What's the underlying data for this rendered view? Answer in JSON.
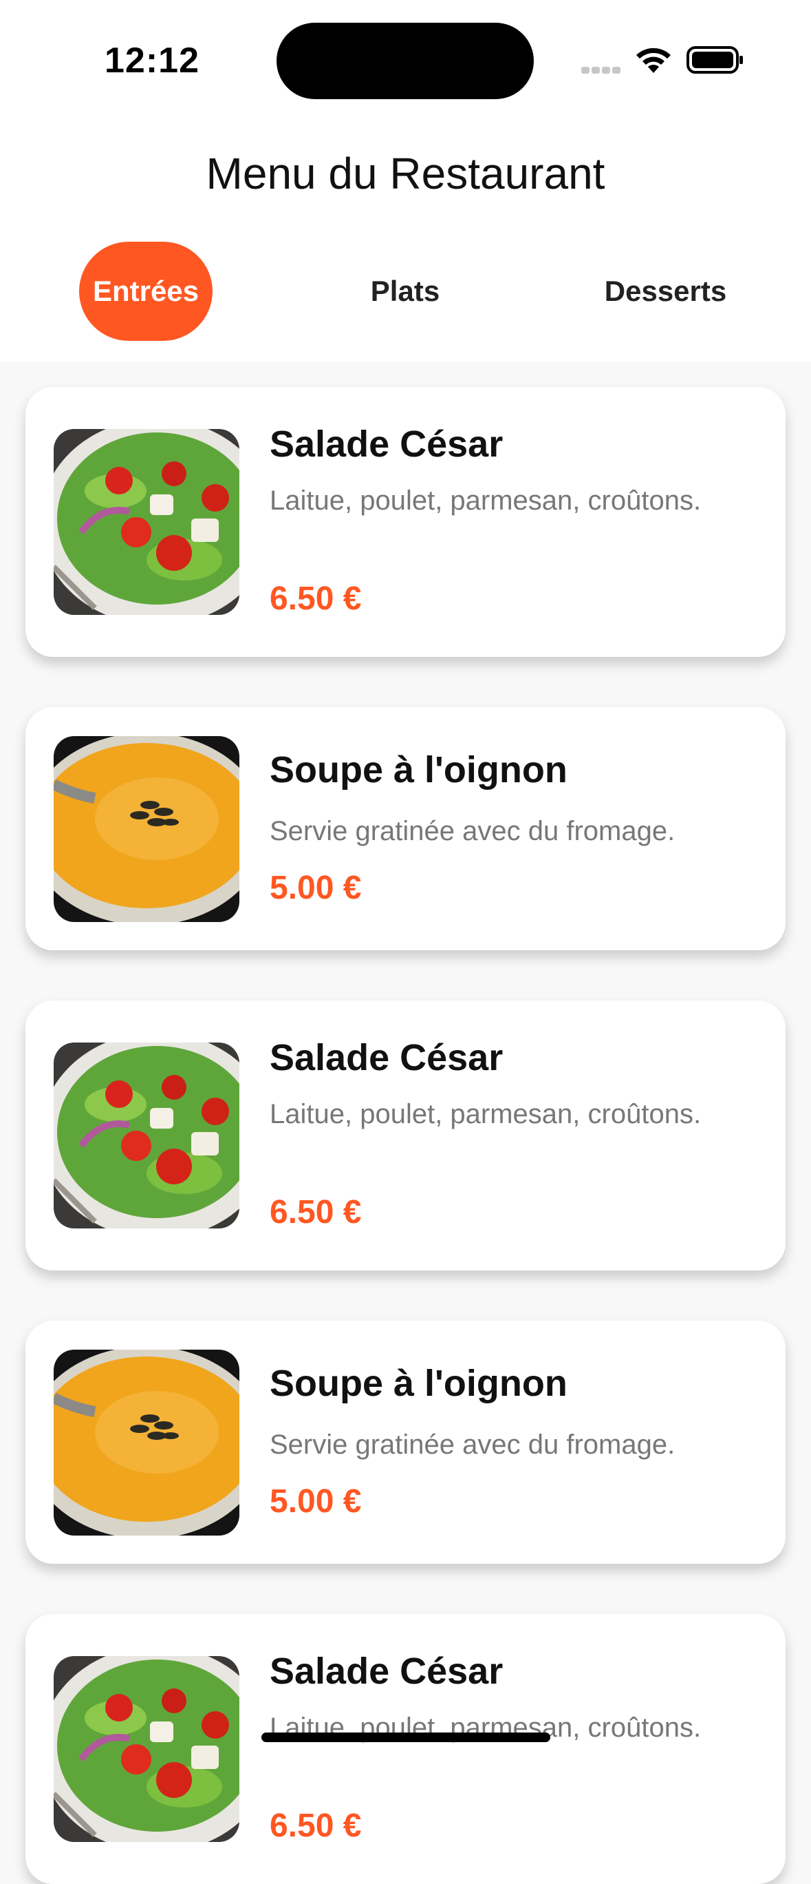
{
  "status": {
    "time": "12:12"
  },
  "header": {
    "title": "Menu du Restaurant"
  },
  "tabs": [
    {
      "label": "Entrées",
      "active": true
    },
    {
      "label": "Plats",
      "active": false
    },
    {
      "label": "Desserts",
      "active": false
    }
  ],
  "accent_color": "#ff5722",
  "items": [
    {
      "name": "Salade César",
      "description": "Laitue, poulet, parmesan, croûtons.",
      "price": "6.50 €",
      "image": "salad"
    },
    {
      "name": "Soupe à l'oignon",
      "description": "Servie gratinée avec du fromage.",
      "price": "5.00 €",
      "image": "soup"
    },
    {
      "name": "Salade César",
      "description": "Laitue, poulet, parmesan, croûtons.",
      "price": "6.50 €",
      "image": "salad"
    },
    {
      "name": "Soupe à l'oignon",
      "description": "Servie gratinée avec du fromage.",
      "price": "5.00 €",
      "image": "soup"
    },
    {
      "name": "Salade César",
      "description": "Laitue, poulet, parmesan, croûtons.",
      "price": "6.50 €",
      "image": "salad"
    }
  ]
}
